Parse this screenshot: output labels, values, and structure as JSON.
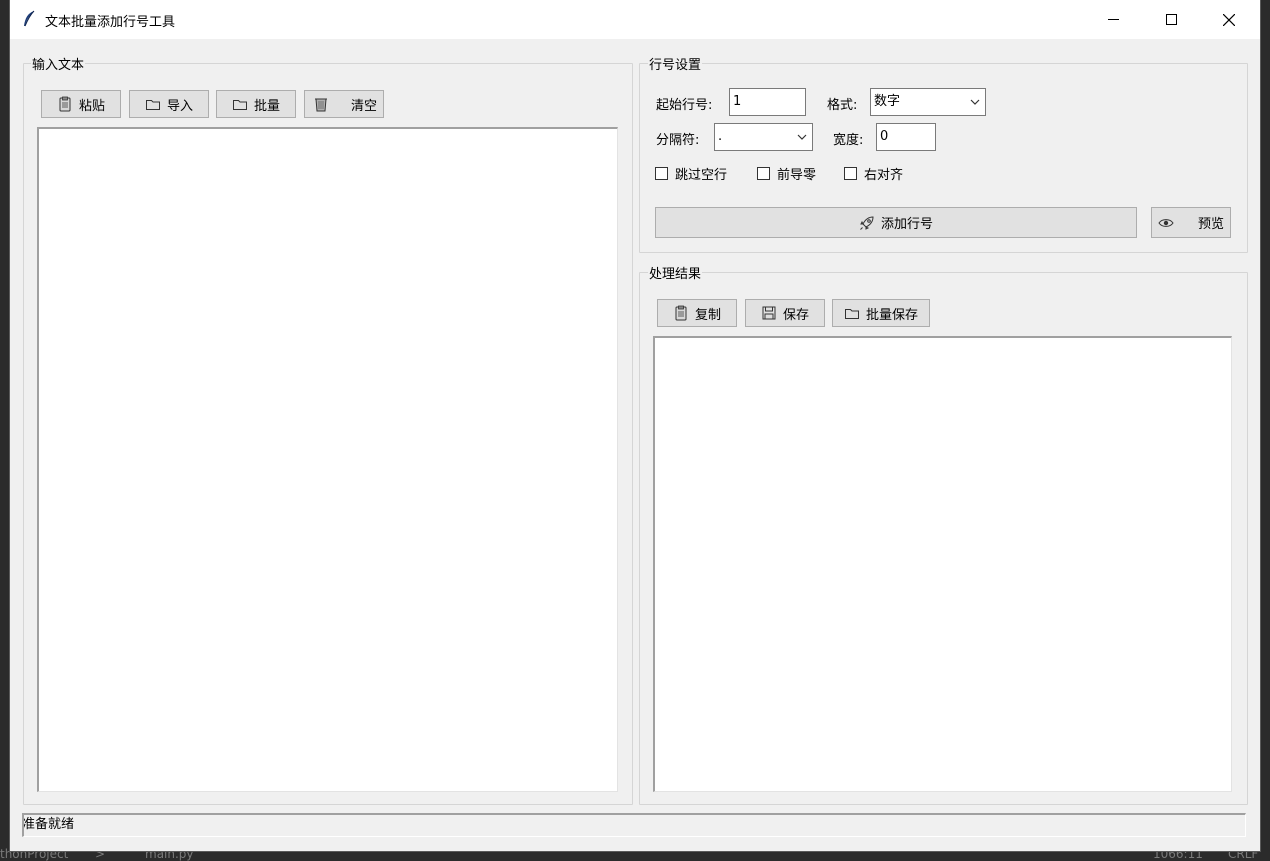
{
  "window": {
    "title": "文本批量添加行号工具"
  },
  "input_panel": {
    "label": "输入文本",
    "buttons": {
      "paste": "粘贴",
      "import": "导入",
      "batch": "批量",
      "clear": "清空"
    }
  },
  "settings_panel": {
    "label": "行号设置",
    "start_label": "起始行号:",
    "start_value": "1",
    "format_label": "格式:",
    "format_value": "数字",
    "separator_label": "分隔符:",
    "separator_value": ".",
    "width_label": "宽度:",
    "width_value": "0",
    "checkboxes": {
      "skip_empty": "跳过空行",
      "leading_zero": "前导零",
      "right_align": "右对齐"
    },
    "add_button": "添加行号",
    "preview_button": "预览"
  },
  "result_panel": {
    "label": "处理结果",
    "buttons": {
      "copy": "复制",
      "save": "保存",
      "batch_save": "批量保存"
    }
  },
  "status": {
    "text": "准备就绪"
  },
  "background_ide": {
    "project": "thonProject",
    "file": "main.py",
    "position": "1066:11",
    "line_ending": "CRLF"
  }
}
